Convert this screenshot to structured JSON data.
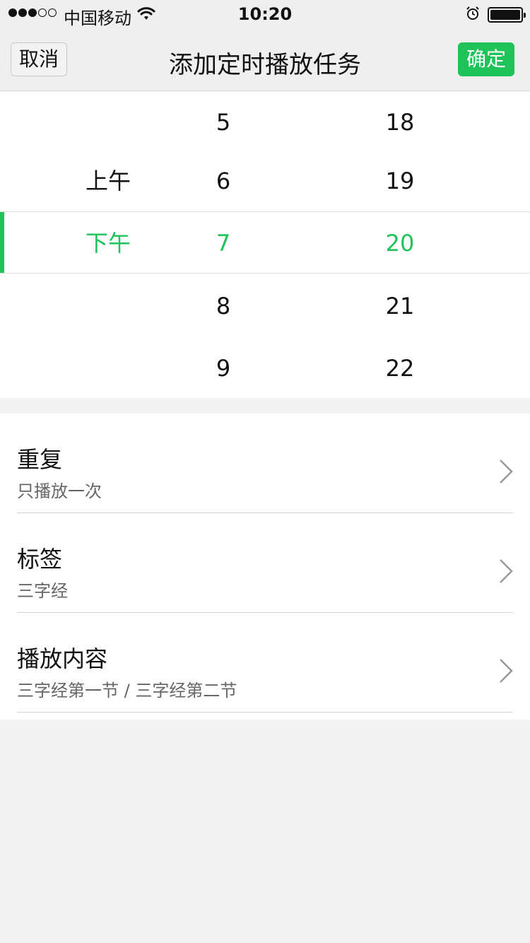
{
  "status_bar": {
    "carrier": "中国移动",
    "time": "10:20"
  },
  "nav": {
    "cancel_label": "取消",
    "title": "添加定时播放任务",
    "confirm_label": "确定"
  },
  "picker": {
    "rows": [
      {
        "ampm": "",
        "hour": "5",
        "minute": "18"
      },
      {
        "ampm": "上午",
        "hour": "6",
        "minute": "19"
      },
      {
        "ampm": "下午",
        "hour": "7",
        "minute": "20"
      },
      {
        "ampm": "",
        "hour": "8",
        "minute": "21"
      },
      {
        "ampm": "",
        "hour": "9",
        "minute": "22"
      }
    ],
    "accent_color": "#1fc35a"
  },
  "settings": [
    {
      "title": "重复",
      "value": "只播放一次"
    },
    {
      "title": "标签",
      "value": "三字经"
    },
    {
      "title": "播放内容",
      "value": "三字经第一节 / 三字经第二节"
    }
  ],
  "icons": {
    "wifi": "wifi-icon",
    "alarm": "alarm-icon",
    "battery": "battery-icon",
    "chevron": "chevron-right-icon"
  }
}
